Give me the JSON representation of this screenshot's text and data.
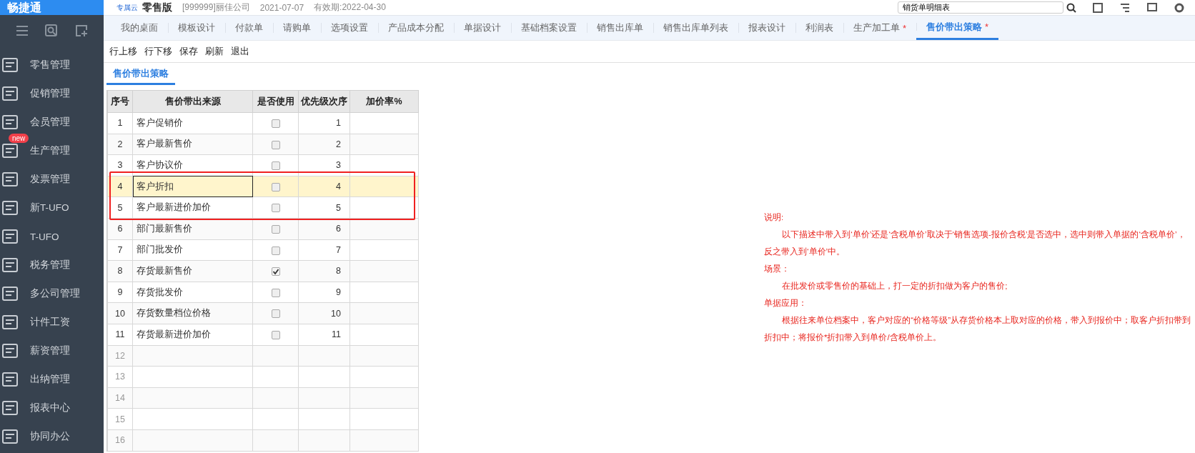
{
  "header": {
    "logo": "畅捷通",
    "cloud_badge": "专属云",
    "edition": "零售版",
    "company": "[999999]丽佳公司",
    "date": "2021-07-07",
    "expiry": "有效期:2022-04-30",
    "search": {
      "value": "销货单明细表"
    }
  },
  "sidebar": {
    "items": [
      {
        "label": "零售管理"
      },
      {
        "label": "促销管理"
      },
      {
        "label": "会员管理"
      },
      {
        "label": "生产管理",
        "badge": "new"
      },
      {
        "label": "发票管理"
      },
      {
        "label": "新T-UFO"
      },
      {
        "label": "T-UFO"
      },
      {
        "label": "税务管理"
      },
      {
        "label": "多公司管理"
      },
      {
        "label": "计件工资"
      },
      {
        "label": "薪资管理"
      },
      {
        "label": "出纳管理"
      },
      {
        "label": "报表中心"
      },
      {
        "label": "协同办公"
      }
    ]
  },
  "tabs": [
    {
      "label": "我的桌面",
      "modified": false,
      "selected": false
    },
    {
      "label": "模板设计",
      "modified": false,
      "selected": false
    },
    {
      "label": "付款单",
      "modified": false,
      "selected": false
    },
    {
      "label": "请购单",
      "modified": false,
      "selected": false
    },
    {
      "label": "选项设置",
      "modified": false,
      "selected": false
    },
    {
      "label": "产品成本分配",
      "modified": false,
      "selected": false
    },
    {
      "label": "单据设计",
      "modified": false,
      "selected": false
    },
    {
      "label": "基础档案设置",
      "modified": false,
      "selected": false
    },
    {
      "label": "销售出库单",
      "modified": false,
      "selected": false
    },
    {
      "label": "销售出库单列表",
      "modified": false,
      "selected": false
    },
    {
      "label": "报表设计",
      "modified": false,
      "selected": false
    },
    {
      "label": "利润表",
      "modified": false,
      "selected": false
    },
    {
      "label": "生产加工单",
      "modified": true,
      "selected": false
    },
    {
      "label": "售价带出策略",
      "modified": true,
      "selected": true
    }
  ],
  "modified_mark": "*",
  "toolbar": [
    "行上移",
    "行下移",
    "保存",
    "刷新",
    "退出"
  ],
  "subtab": {
    "label": "售价带出策略",
    "selected": true
  },
  "table": {
    "columns": [
      "序号",
      "售价带出来源",
      "是否使用",
      "优先级次序",
      "加价率%"
    ],
    "rows": [
      {
        "kind": "data",
        "no": "1",
        "source": "客户促销价",
        "checked": false,
        "priority": "1",
        "selected": false
      },
      {
        "kind": "data",
        "no": "2",
        "source": "客户最新售价",
        "checked": false,
        "priority": "2",
        "selected": false
      },
      {
        "kind": "data",
        "no": "3",
        "source": "客户协议价",
        "checked": false,
        "priority": "3",
        "selected": false
      },
      {
        "kind": "data",
        "no": "4",
        "source": "客户折扣",
        "checked": false,
        "priority": "4",
        "selected": true
      },
      {
        "kind": "data",
        "no": "5",
        "source": "客户最新进价加价",
        "checked": false,
        "priority": "5",
        "selected": false
      },
      {
        "kind": "data",
        "no": "6",
        "source": "部门最新售价",
        "checked": false,
        "priority": "6",
        "selected": false
      },
      {
        "kind": "data",
        "no": "7",
        "source": "部门批发价",
        "checked": false,
        "priority": "7",
        "selected": false
      },
      {
        "kind": "data",
        "no": "8",
        "source": "存货最新售价",
        "checked": true,
        "priority": "8",
        "selected": false
      },
      {
        "kind": "data",
        "no": "9",
        "source": "存货批发价",
        "checked": false,
        "priority": "9",
        "selected": false
      },
      {
        "kind": "data",
        "no": "10",
        "source": "存货数量档位价格",
        "checked": false,
        "priority": "10",
        "selected": false
      },
      {
        "kind": "data",
        "no": "11",
        "source": "存货最新进价加价",
        "checked": false,
        "priority": "11",
        "selected": false
      },
      {
        "kind": "blank",
        "no": "12"
      },
      {
        "kind": "blank",
        "no": "13"
      },
      {
        "kind": "blank",
        "no": "14"
      },
      {
        "kind": "blank",
        "no": "15"
      },
      {
        "kind": "blank",
        "no": "16"
      }
    ]
  },
  "note": [
    {
      "kind": "heading",
      "text": "说明:"
    },
    {
      "kind": "body",
      "text": "以下描述中带入到‘单价’还是‘含税单价’取决于‘销售选项-报价含税’是否选中，选中则带入单据的‘含税单价’，反之带入到‘单价’中。"
    },
    {
      "kind": "heading",
      "text": "场景："
    },
    {
      "kind": "body",
      "text": "在批发价或零售价的基础上，打一定的折扣做为客户的售价;"
    },
    {
      "kind": "heading",
      "text": "单据应用："
    },
    {
      "kind": "body",
      "text": "根据往来单位档案中，客户对应的“价格等级”从存货价格本上取对应的价格，带入到报价中；取客户折扣带到折扣中；将报价*折扣带入到单价/含税单价上。"
    }
  ]
}
